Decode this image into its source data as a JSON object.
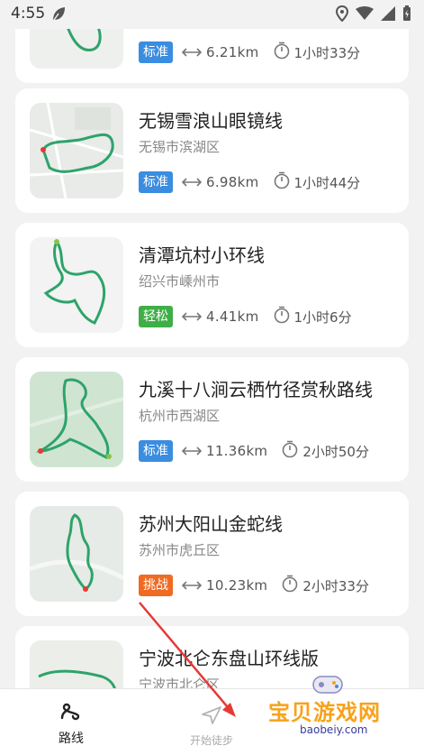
{
  "status_bar": {
    "time": "4:55"
  },
  "routes": [
    {
      "title": "",
      "city": "",
      "difficulty": "标准",
      "difficulty_color": "#3a8de0",
      "distance": "6.21km",
      "duration": "1小时33分"
    },
    {
      "title": "无锡雪浪山眼镜线",
      "city": "无锡市滨湖区",
      "difficulty": "标准",
      "difficulty_color": "#3a8de0",
      "distance": "6.98km",
      "duration": "1小时44分"
    },
    {
      "title": "清潭坑村小环线",
      "city": "绍兴市嵊州市",
      "difficulty": "轻松",
      "difficulty_color": "#3fae47",
      "distance": "4.41km",
      "duration": "1小时6分"
    },
    {
      "title": "九溪十八涧云栖竹径赏秋路线",
      "city": "杭州市西湖区",
      "difficulty": "标准",
      "difficulty_color": "#3a8de0",
      "distance": "11.36km",
      "duration": "2小时50分"
    },
    {
      "title": "苏州大阳山金蛇线",
      "city": "苏州市虎丘区",
      "difficulty": "挑战",
      "difficulty_color": "#ef6a23",
      "distance": "10.23km",
      "duration": "2小时33分"
    },
    {
      "title": "宁波北仑东盘山环线版",
      "city": "宁波市北仑区",
      "difficulty": "",
      "difficulty_color": "",
      "distance": "",
      "duration": ""
    }
  ],
  "tabbar": {
    "routes_label": "路线",
    "start_label": "开始徒步"
  },
  "watermark": {
    "text": "宝贝游戏网",
    "url": "baobeiy.com"
  }
}
